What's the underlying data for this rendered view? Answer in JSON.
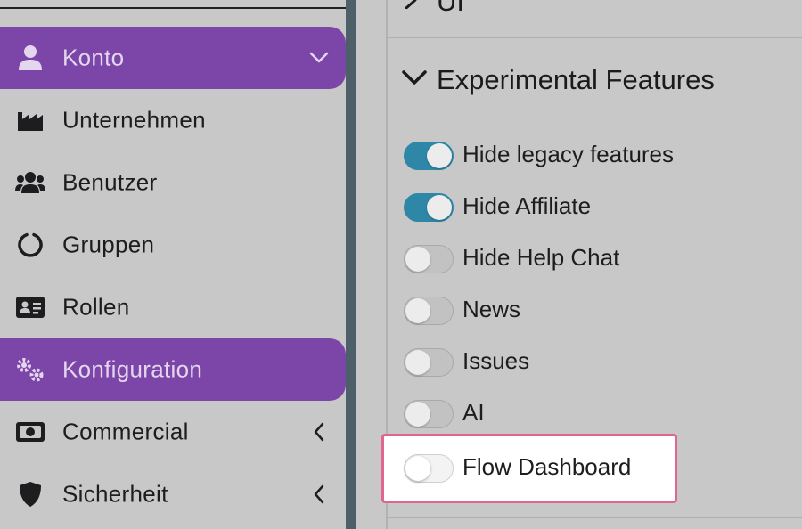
{
  "sidebar": {
    "items": [
      {
        "label": "Konto",
        "icon": "user-icon",
        "active": true,
        "chevron": "chevron-down-icon"
      },
      {
        "label": "Unternehmen",
        "icon": "factory-icon"
      },
      {
        "label": "Benutzer",
        "icon": "users-icon"
      },
      {
        "label": "Gruppen",
        "icon": "circle-notch-icon"
      },
      {
        "label": "Rollen",
        "icon": "id-card-icon"
      },
      {
        "label": "Konfiguration",
        "icon": "gears-icon",
        "active": true
      },
      {
        "label": "Commercial",
        "icon": "money-bill-icon",
        "chevron": "chevron-left-icon"
      },
      {
        "label": "Sicherheit",
        "icon": "shield-icon",
        "chevron": "chevron-left-icon"
      }
    ]
  },
  "panel": {
    "previous_section_title": "UI",
    "section_title": "Experimental Features",
    "toggles": [
      {
        "label": "Hide legacy features",
        "on": true
      },
      {
        "label": "Hide Affiliate",
        "on": true
      },
      {
        "label": "Hide Help Chat",
        "on": false
      },
      {
        "label": "News",
        "on": false
      },
      {
        "label": "Issues",
        "on": false
      },
      {
        "label": "AI",
        "on": false
      },
      {
        "label": "Flow Dashboard",
        "on": false,
        "highlighted": true
      }
    ]
  },
  "colors": {
    "accent": "#7c46a8",
    "toggle_on": "#2f87a8",
    "highlight_border": "#e2658f",
    "divider": "#4d5f69"
  }
}
